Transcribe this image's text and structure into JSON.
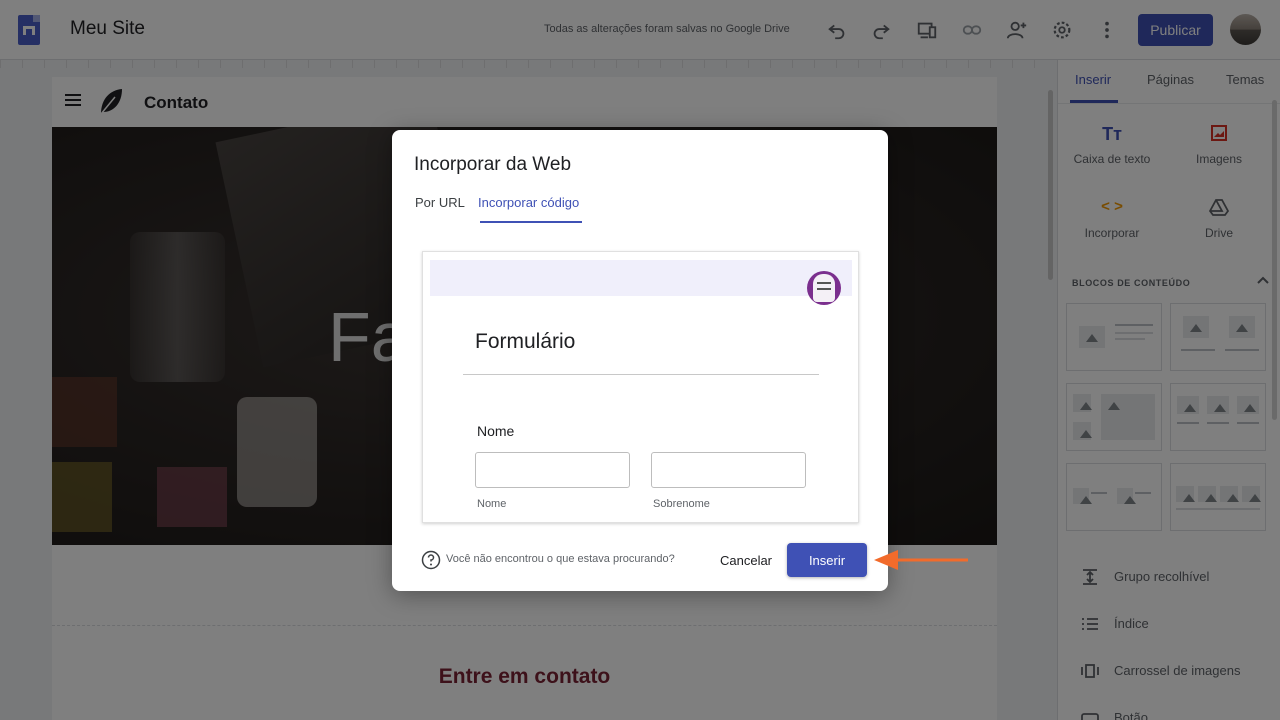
{
  "topbar": {
    "site_title": "Meu Site",
    "save_status": "Todas as alterações foram salvas no Google Drive",
    "publish_label": "Publicar",
    "icons": [
      "undo-icon",
      "redo-icon",
      "preview-devices-icon",
      "link-icon",
      "share-person-add-icon",
      "gear-icon",
      "more-vert-icon"
    ]
  },
  "page": {
    "header_title": "Contato",
    "hero_text": "Fa",
    "section_title": "Entre em contato"
  },
  "right_panel": {
    "tabs": [
      {
        "label": "Inserir",
        "active": true
      },
      {
        "label": "Páginas",
        "active": false
      },
      {
        "label": "Temas",
        "active": false
      }
    ],
    "insert_items": [
      {
        "label": "Caixa de texto",
        "icon": "text-box-icon"
      },
      {
        "label": "Imagens",
        "icon": "image-icon"
      },
      {
        "label": "Incorporar",
        "icon": "embed-code-icon"
      },
      {
        "label": "Drive",
        "icon": "drive-icon"
      }
    ],
    "section_label": "BLOCOS DE CONTEÚDO",
    "list_items": [
      {
        "label": "Grupo recolhível",
        "icon": "collapsible-group-icon"
      },
      {
        "label": "Índice",
        "icon": "table-of-contents-icon"
      },
      {
        "label": "Carrossel de imagens",
        "icon": "carousel-icon"
      },
      {
        "label": "Botão",
        "icon": "button-icon"
      }
    ]
  },
  "dialog": {
    "title": "Incorporar da Web",
    "tabs": [
      {
        "label": "Por URL",
        "active": false
      },
      {
        "label": "Incorporar código",
        "active": true
      }
    ],
    "preview": {
      "form_title": "Formulário",
      "field_label": "Nome",
      "sub_first": "Nome",
      "sub_last": "Sobrenome"
    },
    "help_text": "Você não encontrou o que estava procurando?",
    "cancel_label": "Cancelar",
    "insert_label": "Inserir"
  },
  "colors": {
    "accent": "#3f51b5",
    "arrow": "#f26b2b",
    "section_title": "#7b2335"
  }
}
